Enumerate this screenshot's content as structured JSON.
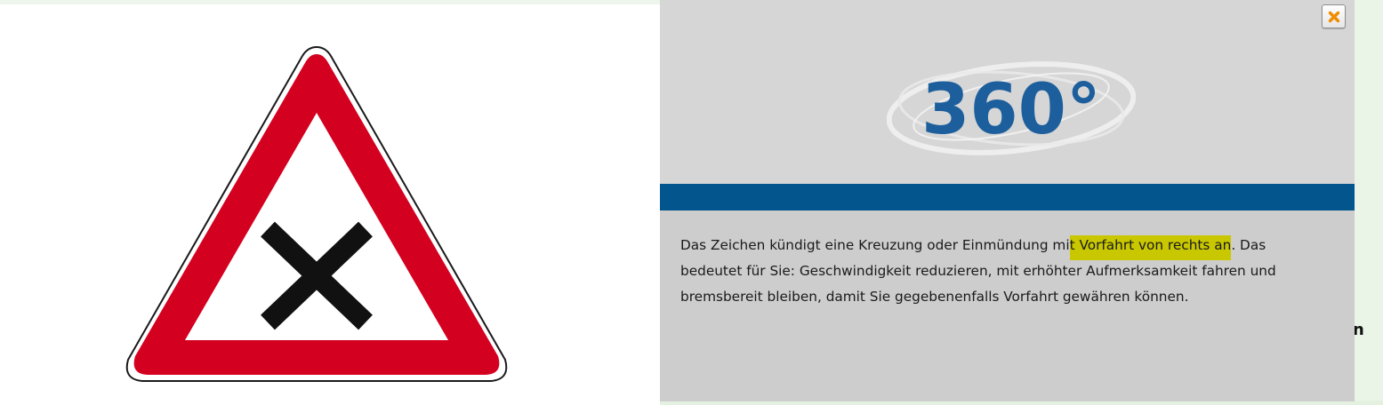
{
  "sign": {
    "icon": "crossroads-warning-sign-icon",
    "colors": {
      "border_red": "#d40020",
      "cross": "#111111",
      "fill": "#ffffff"
    }
  },
  "popup": {
    "logo_text": "360°",
    "logo_color": "#1c5f9c",
    "accent_bar_color": "#03558d",
    "highlight_color": "#c9c800",
    "text_before": "Das Zeichen kündigt eine Kreuzung oder Einmündung mi",
    "text_highlight": "t Vorfahrt von rechts an",
    "text_after": ". Das bedeutet für Sie: Geschwindigkeit reduzieren, mit erhöhter Aufmerksamkeit fahren und bremsbereit bleiben, damit Sie gegebenenfalls Vorfahrt gewähren können.",
    "close_icon": "close-icon",
    "close_color": "#f08c00"
  },
  "background": {
    "peek_text": "n"
  }
}
